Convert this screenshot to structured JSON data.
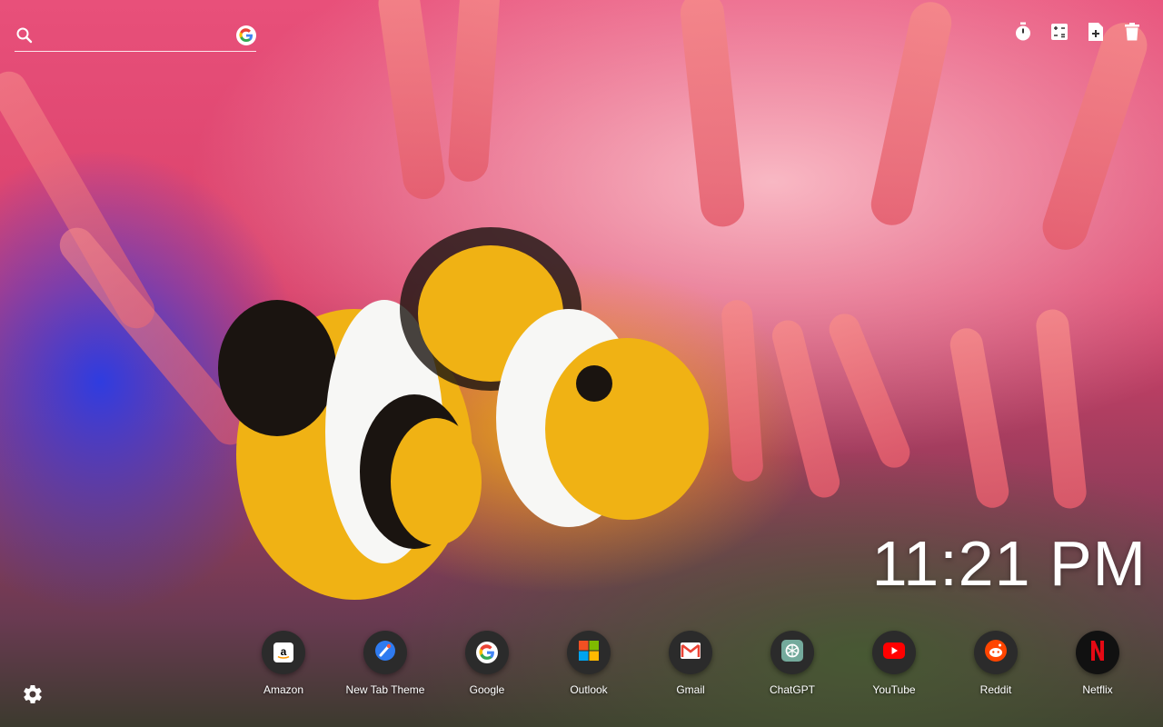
{
  "search": {
    "placeholder": "",
    "value": "",
    "engine_icon": "google-icon"
  },
  "toolbar": {
    "items": [
      {
        "name": "timer",
        "icon": "stopwatch-icon"
      },
      {
        "name": "calculator",
        "icon": "calculator-icon"
      },
      {
        "name": "notes",
        "icon": "add-note-icon"
      },
      {
        "name": "delete",
        "icon": "trash-icon"
      }
    ]
  },
  "clock": {
    "time": "11:21 PM"
  },
  "shortcuts": [
    {
      "label": "Amazon",
      "icon": "amazon-icon"
    },
    {
      "label": "New Tab Theme",
      "icon": "new-tab-theme-icon"
    },
    {
      "label": "Google",
      "icon": "google-icon"
    },
    {
      "label": "Outlook",
      "icon": "microsoft-icon"
    },
    {
      "label": "Gmail",
      "icon": "gmail-icon"
    },
    {
      "label": "ChatGPT",
      "icon": "chatgpt-icon"
    },
    {
      "label": "YouTube",
      "icon": "youtube-icon"
    },
    {
      "label": "Reddit",
      "icon": "reddit-icon"
    },
    {
      "label": "Netflix",
      "icon": "netflix-icon"
    }
  ],
  "settings": {
    "icon": "gear-icon"
  },
  "colors": {
    "clock_text": "#ffffff",
    "shortcut_bg": "#2b2b2b"
  }
}
